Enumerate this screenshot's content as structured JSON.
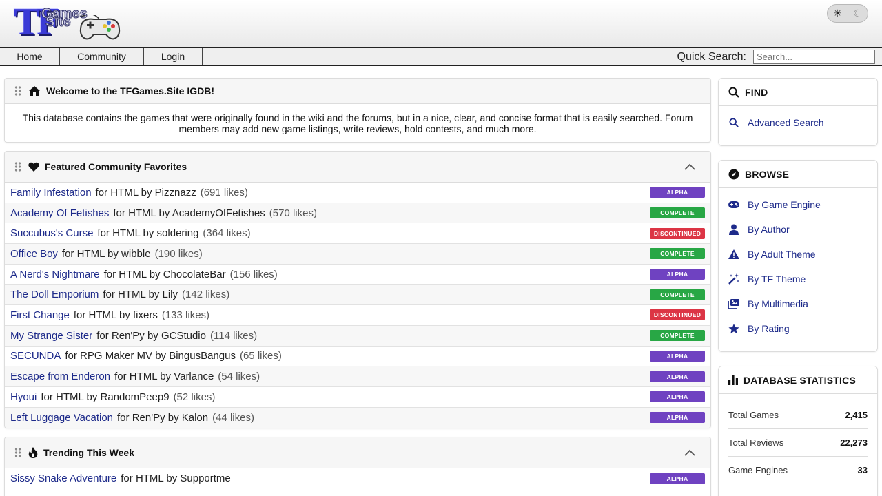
{
  "header": {
    "logo_tf": "TF",
    "logo_games": "Games",
    "logo_site": "Site",
    "theme_toggle": {
      "sun": "☀",
      "moon": "☾"
    }
  },
  "nav": {
    "items": [
      {
        "label": "Home"
      },
      {
        "label": "Community"
      },
      {
        "label": "Login"
      }
    ],
    "quick_search_label": "Quick Search:",
    "quick_search_placeholder": "Search..."
  },
  "welcome": {
    "title": "Welcome to the TFGames.Site IGDB!",
    "body": "This database contains the games that were originally found in the wiki and the forums, but in a nice, clear, and concise format that is easily searched. Forum members may add new game listings, write reviews, hold contests, and much more."
  },
  "featured": {
    "title": "Featured Community Favorites",
    "games": [
      {
        "title": "Family Infestation",
        "meta": "for HTML by Pizznazz",
        "likes": "(691 likes)",
        "status": "ALPHA"
      },
      {
        "title": "Academy Of Fetishes",
        "meta": "for HTML by AcademyOfFetishes",
        "likes": "(570 likes)",
        "status": "COMPLETE"
      },
      {
        "title": "Succubus's Curse",
        "meta": "for HTML by soldering",
        "likes": "(364 likes)",
        "status": "DISCONTINUED"
      },
      {
        "title": "Office Boy",
        "meta": "for HTML by wibble",
        "likes": "(190 likes)",
        "status": "COMPLETE"
      },
      {
        "title": "A Nerd's Nightmare",
        "meta": "for HTML by ChocolateBar",
        "likes": "(156 likes)",
        "status": "ALPHA"
      },
      {
        "title": "The Doll Emporium",
        "meta": "for HTML by Lily",
        "likes": "(142 likes)",
        "status": "COMPLETE"
      },
      {
        "title": "First Change",
        "meta": "for HTML by fixers",
        "likes": "(133 likes)",
        "status": "DISCONTINUED"
      },
      {
        "title": "My Strange Sister",
        "meta": "for Ren'Py by GCStudio",
        "likes": "(114 likes)",
        "status": "COMPLETE"
      },
      {
        "title": "SECUNDA",
        "meta": "for RPG Maker MV by BingusBangus",
        "likes": "(65 likes)",
        "status": "ALPHA"
      },
      {
        "title": "Escape from Enderon",
        "meta": "for HTML by Varlance",
        "likes": "(54 likes)",
        "status": "ALPHA"
      },
      {
        "title": "Hyoui",
        "meta": "for HTML by RandomPeep9",
        "likes": "(52 likes)",
        "status": "ALPHA"
      },
      {
        "title": "Left Luggage Vacation",
        "meta": "for Ren'Py by Kalon",
        "likes": "(44 likes)",
        "status": "ALPHA"
      }
    ]
  },
  "trending": {
    "title": "Trending This Week",
    "games": [
      {
        "title": "Sissy Snake Adventure",
        "meta": "for HTML by Supportme",
        "status": "ALPHA"
      }
    ]
  },
  "find": {
    "title": "FIND",
    "links": [
      {
        "label": "Advanced Search",
        "icon": "search-icon"
      }
    ]
  },
  "browse": {
    "title": "BROWSE",
    "links": [
      {
        "label": "By Game Engine",
        "icon": "gamepad-icon"
      },
      {
        "label": "By Author",
        "icon": "user-icon"
      },
      {
        "label": "By Adult Theme",
        "icon": "warning-icon"
      },
      {
        "label": "By TF Theme",
        "icon": "magic-wand-icon"
      },
      {
        "label": "By Multimedia",
        "icon": "images-icon"
      },
      {
        "label": "By Rating",
        "icon": "star-icon"
      }
    ]
  },
  "stats": {
    "title": "DATABASE STATISTICS",
    "rows": [
      {
        "label": "Total Games",
        "value": "2,415"
      },
      {
        "label": "Total Reviews",
        "value": "22,273"
      },
      {
        "label": "Game Engines",
        "value": "33"
      }
    ]
  },
  "colors": {
    "link": "#1d2a8a",
    "ALPHA": "#6f42c1",
    "COMPLETE": "#28a745",
    "DISCONTINUED": "#dc3545"
  }
}
